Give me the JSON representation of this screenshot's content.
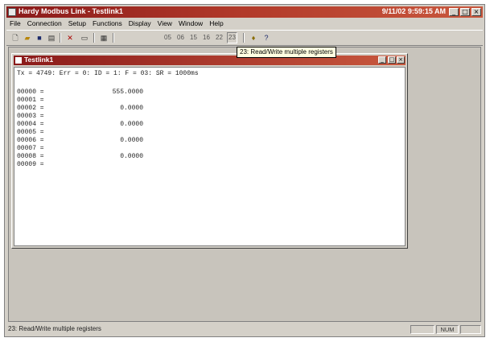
{
  "app": {
    "title": "Hardy Modbus Link - Testlink1",
    "clock": "9/11/02 9:59:15 AM",
    "window_buttons": [
      "minimize-icon",
      "maximize-icon",
      "close-icon"
    ]
  },
  "menu": [
    "File",
    "Connection",
    "Setup",
    "Functions",
    "Display",
    "View",
    "Window",
    "Help"
  ],
  "toolbar": {
    "icons": [
      "new-icon",
      "open-icon",
      "save-icon",
      "print-icon",
      "cut-icon",
      "copy-icon",
      "paste-icon"
    ],
    "functions": [
      "05",
      "06",
      "15",
      "16",
      "22",
      "23"
    ],
    "extra_icons": [
      "lightbulb-icon",
      "help-icon"
    ]
  },
  "tooltip": "23: Read/Write multiple registers",
  "child": {
    "title": "Testlink1",
    "status_line": "Tx = 4749: Err = 0: ID = 1: F = 03: SR = 1000ms",
    "registers": [
      {
        "addr": "00000 =",
        "value": "555.0000"
      },
      {
        "addr": "00001 =",
        "value": ""
      },
      {
        "addr": "00002 =",
        "value": "0.0000"
      },
      {
        "addr": "00003 =",
        "value": ""
      },
      {
        "addr": "00004 =",
        "value": "0.0000"
      },
      {
        "addr": "00005 =",
        "value": ""
      },
      {
        "addr": "00006 =",
        "value": "0.0000"
      },
      {
        "addr": "00007 =",
        "value": ""
      },
      {
        "addr": "00008 =",
        "value": "0.0000"
      },
      {
        "addr": "00009 =",
        "value": ""
      }
    ]
  },
  "statusbar": {
    "message": "23: Read/Write multiple registers",
    "num": "NUM"
  }
}
